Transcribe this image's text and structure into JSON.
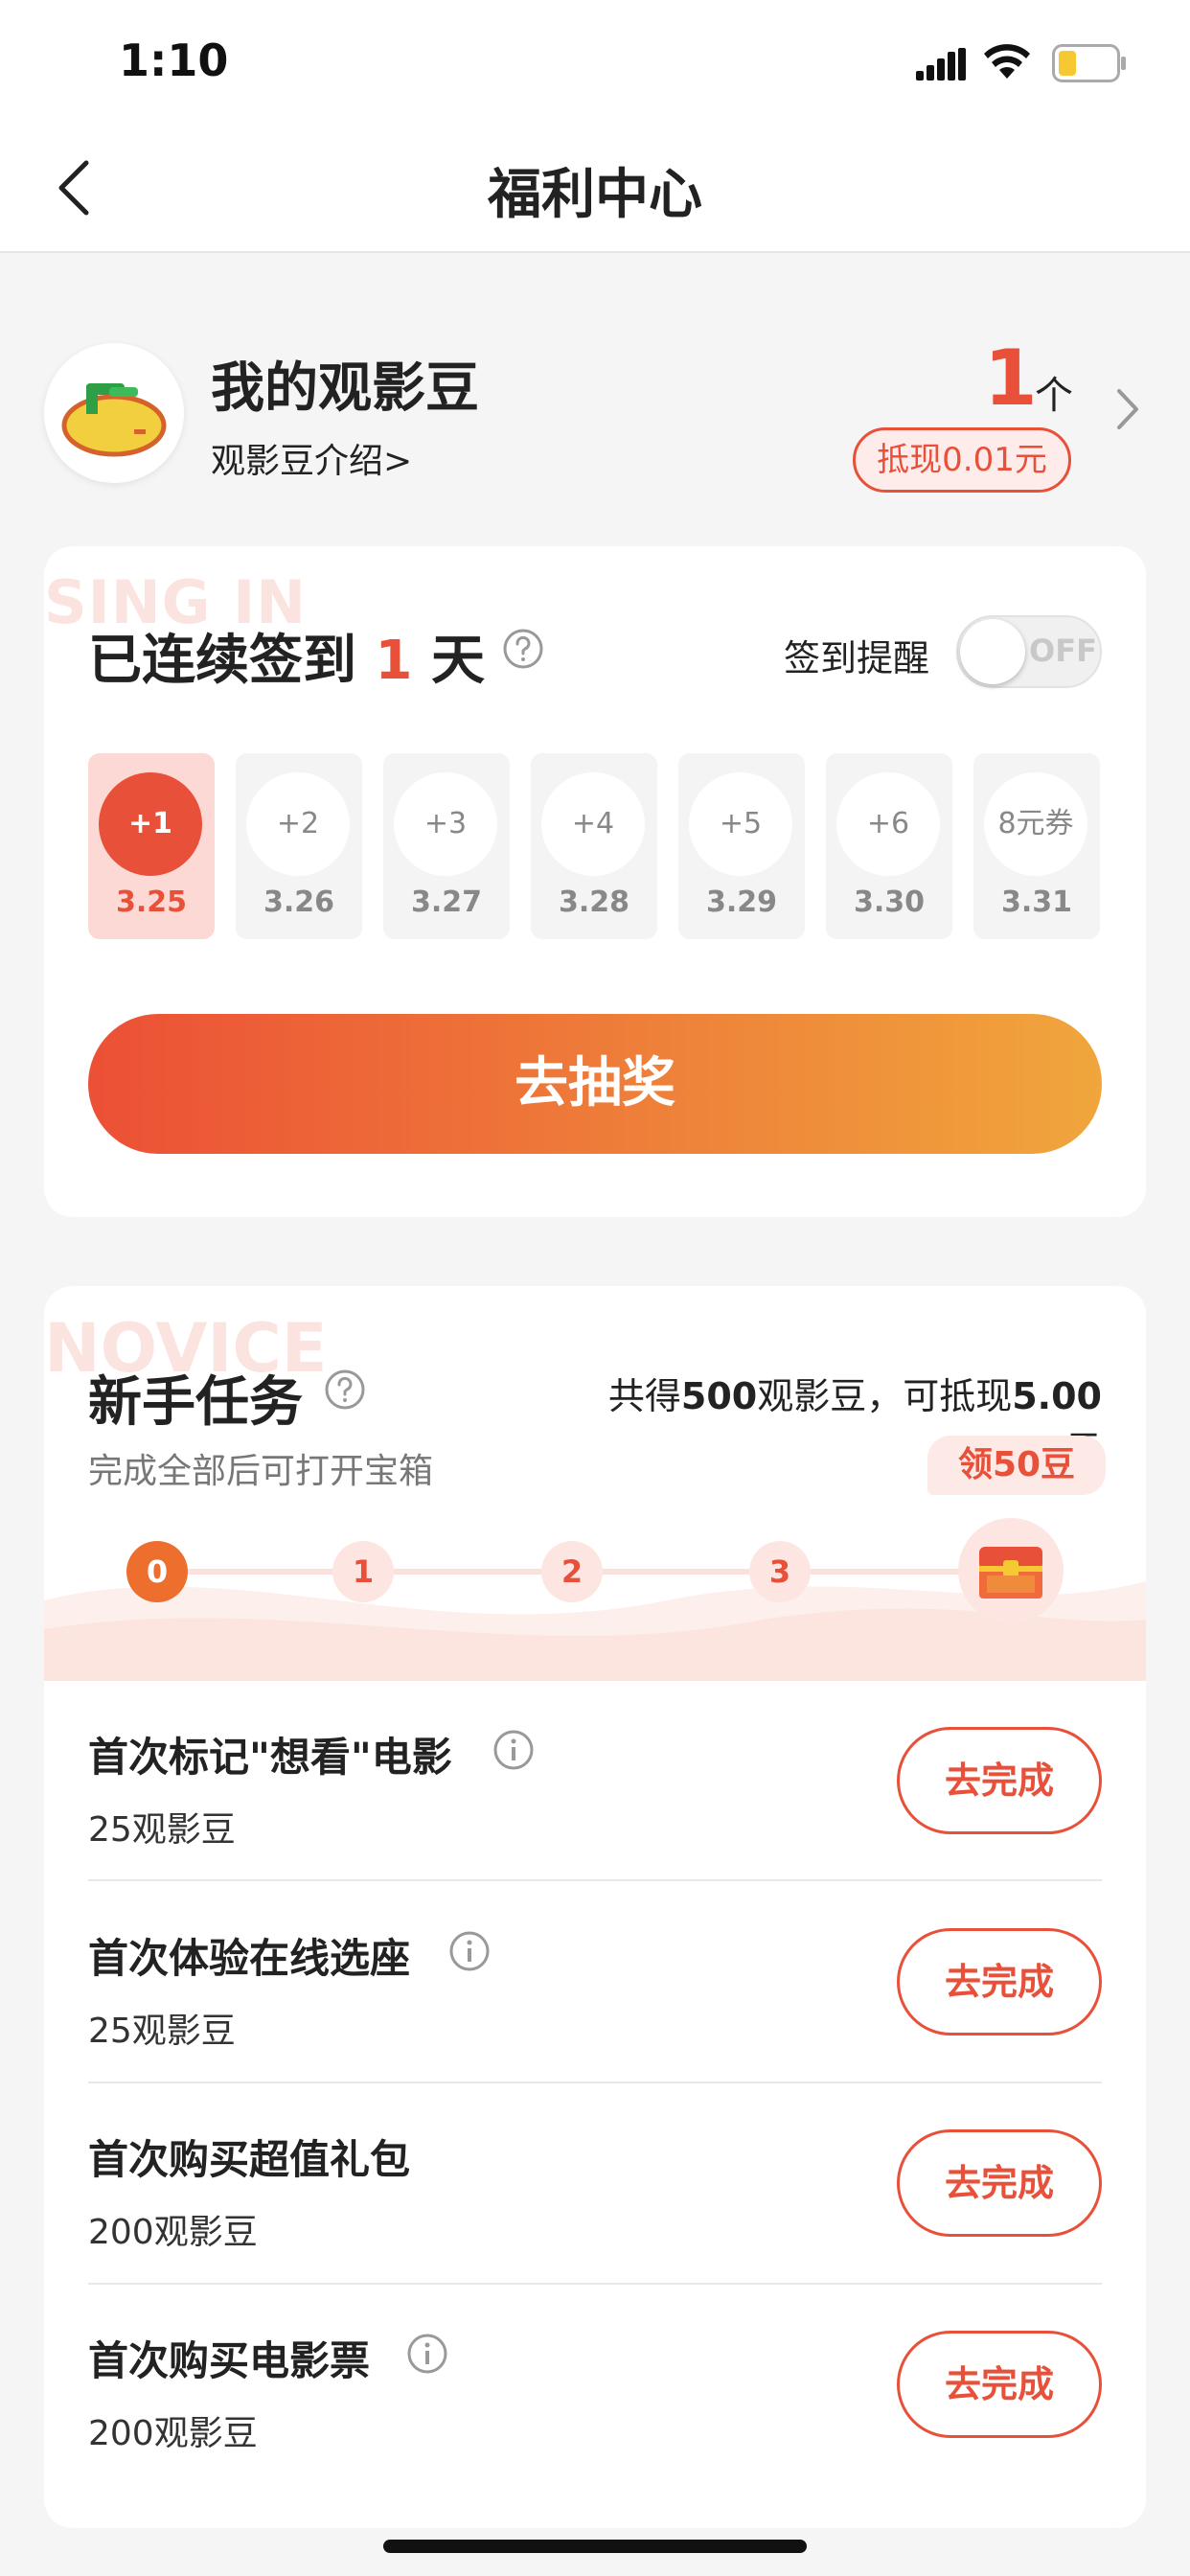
{
  "status_bar": {
    "time": "1:10"
  },
  "nav": {
    "title": "福利中心"
  },
  "beans": {
    "title": "我的观影豆",
    "intro_link": "观影豆介绍>",
    "count": "1",
    "unit": "个",
    "cash_value": "抵现0.01元"
  },
  "signin": {
    "watermark": "SING IN",
    "title_prefix": "已连续签到",
    "days": "1",
    "title_suffix": "天",
    "reminder_label": "签到提醒",
    "toggle_text": "OFF",
    "items": [
      {
        "reward": "+1",
        "date": "3.25",
        "active": true
      },
      {
        "reward": "+2",
        "date": "3.26"
      },
      {
        "reward": "+3",
        "date": "3.27"
      },
      {
        "reward": "+4",
        "date": "3.28"
      },
      {
        "reward": "+5",
        "date": "3.29"
      },
      {
        "reward": "+6",
        "date": "3.30"
      },
      {
        "reward": "8元券",
        "date": "3.31"
      }
    ],
    "lottery_button": "去抽奖"
  },
  "novice": {
    "watermark": "NOVICE",
    "title": "新手任务",
    "reward_prefix": "共得",
    "reward_beans": "500",
    "reward_mid": "观影豆，可抵现",
    "reward_cash": "5.00",
    "reward_suffix": "元",
    "subtitle": "完成全部后可打开宝箱",
    "claim_badge": "领50豆",
    "steps": [
      "0",
      "1",
      "2",
      "3"
    ],
    "tasks": [
      {
        "name": "首次标记\"想看\"电影",
        "beans": "25观影豆",
        "button": "去完成"
      },
      {
        "name": "首次体验在线选座",
        "beans": "25观影豆",
        "button": "去完成"
      },
      {
        "name": "首次购买超值礼包",
        "beans": "200观影豆",
        "button": "去完成"
      },
      {
        "name": "首次购买电影票",
        "beans": "200观影豆",
        "button": "去完成"
      }
    ]
  },
  "colors": {
    "accent": "#e8503a",
    "gradient_end": "#f0a63c"
  }
}
